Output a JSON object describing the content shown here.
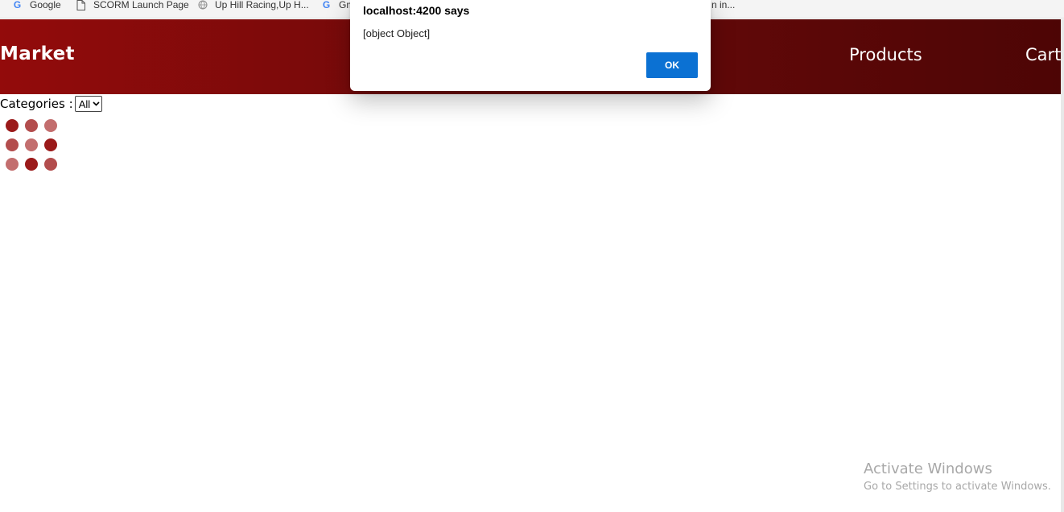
{
  "bookmarks": [
    {
      "label": "Google",
      "icon": "google-g-icon"
    },
    {
      "label": "SCORM Launch Page",
      "icon": "document-icon"
    },
    {
      "label": "Up Hill Racing,Up H...",
      "icon": "globe-icon"
    },
    {
      "label": "Gm",
      "icon": "google-g-icon"
    },
    {
      "label": "n in...",
      "icon": ""
    }
  ],
  "navbar": {
    "brand": "Market",
    "links": [
      "Products",
      "Cart"
    ],
    "colors": {
      "start": "#930b0b",
      "end": "#4d0505"
    }
  },
  "filter": {
    "label": "Categories :",
    "selected": "All"
  },
  "loader": {
    "dot_colors": [
      "#9b1a1a",
      "#b34d4d",
      "#c36e6e",
      "#b34d4d",
      "#c36e6e",
      "#9b1a1a",
      "#c36e6e",
      "#9b1a1a",
      "#b34d4d"
    ]
  },
  "dialog": {
    "title": "localhost:4200 says",
    "message": "[object Object]",
    "ok_label": "OK",
    "button_color": "#0b71d3"
  },
  "watermark": {
    "title": "Activate Windows",
    "subtitle": "Go to Settings to activate Windows."
  }
}
